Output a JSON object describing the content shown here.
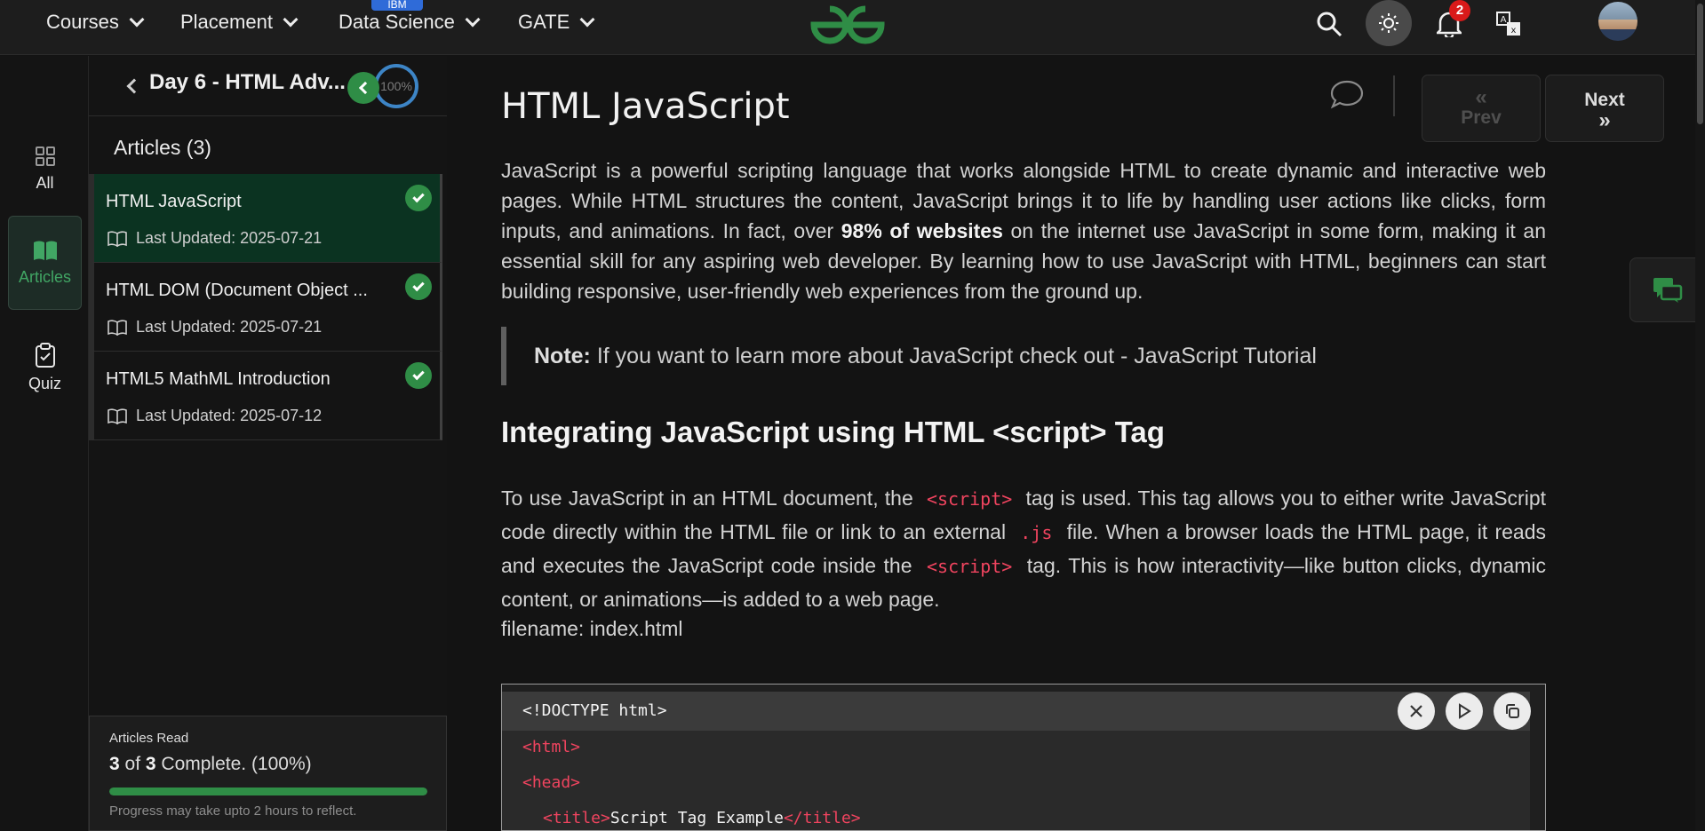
{
  "topnav": {
    "items": [
      {
        "label": "Courses"
      },
      {
        "label": "Placement"
      },
      {
        "label": "Data Science",
        "badge": "IBM"
      },
      {
        "label": "GATE"
      }
    ],
    "notification_count": "2",
    "icons": [
      "search-icon",
      "theme-icon",
      "bell-icon",
      "translate-icon"
    ],
    "brand_color": "#2f8d46"
  },
  "rail": {
    "items": [
      {
        "label": "All",
        "icon": "grid-icon"
      },
      {
        "label": "Articles",
        "icon": "book-icon"
      },
      {
        "label": "Quiz",
        "icon": "clipboard-icon"
      }
    ]
  },
  "panel": {
    "day_title": "Day 6 - HTML Adv...",
    "progress": "100%",
    "articles_title": "Articles (3)",
    "articles": [
      {
        "name": "HTML JavaScript",
        "date": "Last Updated: 2025-07-21",
        "done": true
      },
      {
        "name": "HTML DOM (Document Object ...",
        "date": "Last Updated: 2025-07-21",
        "done": true
      },
      {
        "name": "HTML5 MathML Introduction",
        "date": "Last Updated: 2025-07-12",
        "done": true
      }
    ],
    "read": {
      "label": "Articles Read",
      "done_count": "3",
      "total_text": " of ",
      "total_count": "3",
      "suffix": " Complete. (100%)",
      "progress_fraction": 1.0,
      "note": "Progress may take upto 2 hours to reflect."
    }
  },
  "main": {
    "title": "HTML JavaScript",
    "prev_label": "Prev",
    "next_label": "Next",
    "intro_a": "JavaScript is a powerful scripting language that works alongside HTML to create dynamic and interactive web pages. While HTML structures the content, JavaScript brings it to life by handling user actions like clicks, form inputs, and animations. In fact, over ",
    "intro_bold": "98% of websites",
    "intro_b": " on the internet use JavaScript in some form, making it an essential skill for any aspiring web developer. By learning how to use JavaScript with HTML, beginners can start building responsive, user-friendly web experiences from the ground up.",
    "note_label": "Note:",
    "note_text": " If you want to learn more about JavaScript check out - JavaScript Tutorial",
    "heading": "Integrating JavaScript using HTML <script> Tag",
    "p2_a": "To use JavaScript in an HTML document, the",
    "p2_code1": "<script>",
    "p2_b": "tag is used. This tag allows you to either write JavaScript code directly within the HTML file or link to an external",
    "p2_code2": ".js",
    "p2_c": "file. When a browser loads the HTML page, it reads and executes the JavaScript code inside the",
    "p2_code3": "<script>",
    "p2_d": "tag. This is how interactivity—like button clicks, dynamic content, or animations—is added to a web page.",
    "filename": "filename: index.html",
    "code": {
      "line1": "<!DOCTYPE html>",
      "line2": "<html>",
      "line3": "<head>",
      "line4_open": "<title>",
      "line4_text": "Script Tag Example",
      "line4_close": "</title>"
    }
  }
}
